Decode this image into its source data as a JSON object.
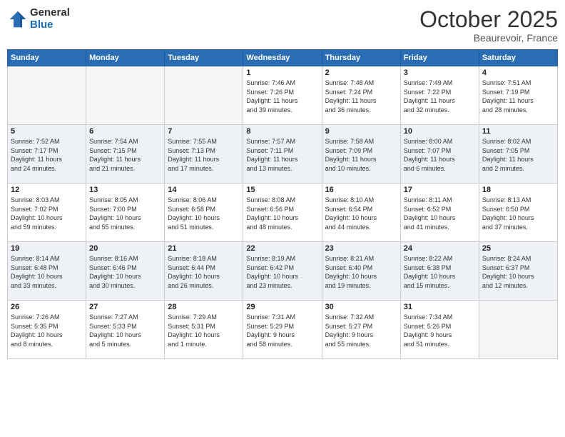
{
  "logo": {
    "general": "General",
    "blue": "Blue"
  },
  "header": {
    "month": "October 2025",
    "location": "Beaurevoir, France"
  },
  "days_of_week": [
    "Sunday",
    "Monday",
    "Tuesday",
    "Wednesday",
    "Thursday",
    "Friday",
    "Saturday"
  ],
  "weeks": [
    [
      {
        "day": "",
        "info": ""
      },
      {
        "day": "",
        "info": ""
      },
      {
        "day": "",
        "info": ""
      },
      {
        "day": "1",
        "info": "Sunrise: 7:46 AM\nSunset: 7:26 PM\nDaylight: 11 hours\nand 39 minutes."
      },
      {
        "day": "2",
        "info": "Sunrise: 7:48 AM\nSunset: 7:24 PM\nDaylight: 11 hours\nand 36 minutes."
      },
      {
        "day": "3",
        "info": "Sunrise: 7:49 AM\nSunset: 7:22 PM\nDaylight: 11 hours\nand 32 minutes."
      },
      {
        "day": "4",
        "info": "Sunrise: 7:51 AM\nSunset: 7:19 PM\nDaylight: 11 hours\nand 28 minutes."
      }
    ],
    [
      {
        "day": "5",
        "info": "Sunrise: 7:52 AM\nSunset: 7:17 PM\nDaylight: 11 hours\nand 24 minutes."
      },
      {
        "day": "6",
        "info": "Sunrise: 7:54 AM\nSunset: 7:15 PM\nDaylight: 11 hours\nand 21 minutes."
      },
      {
        "day": "7",
        "info": "Sunrise: 7:55 AM\nSunset: 7:13 PM\nDaylight: 11 hours\nand 17 minutes."
      },
      {
        "day": "8",
        "info": "Sunrise: 7:57 AM\nSunset: 7:11 PM\nDaylight: 11 hours\nand 13 minutes."
      },
      {
        "day": "9",
        "info": "Sunrise: 7:58 AM\nSunset: 7:09 PM\nDaylight: 11 hours\nand 10 minutes."
      },
      {
        "day": "10",
        "info": "Sunrise: 8:00 AM\nSunset: 7:07 PM\nDaylight: 11 hours\nand 6 minutes."
      },
      {
        "day": "11",
        "info": "Sunrise: 8:02 AM\nSunset: 7:05 PM\nDaylight: 11 hours\nand 2 minutes."
      }
    ],
    [
      {
        "day": "12",
        "info": "Sunrise: 8:03 AM\nSunset: 7:02 PM\nDaylight: 10 hours\nand 59 minutes."
      },
      {
        "day": "13",
        "info": "Sunrise: 8:05 AM\nSunset: 7:00 PM\nDaylight: 10 hours\nand 55 minutes."
      },
      {
        "day": "14",
        "info": "Sunrise: 8:06 AM\nSunset: 6:58 PM\nDaylight: 10 hours\nand 51 minutes."
      },
      {
        "day": "15",
        "info": "Sunrise: 8:08 AM\nSunset: 6:56 PM\nDaylight: 10 hours\nand 48 minutes."
      },
      {
        "day": "16",
        "info": "Sunrise: 8:10 AM\nSunset: 6:54 PM\nDaylight: 10 hours\nand 44 minutes."
      },
      {
        "day": "17",
        "info": "Sunrise: 8:11 AM\nSunset: 6:52 PM\nDaylight: 10 hours\nand 41 minutes."
      },
      {
        "day": "18",
        "info": "Sunrise: 8:13 AM\nSunset: 6:50 PM\nDaylight: 10 hours\nand 37 minutes."
      }
    ],
    [
      {
        "day": "19",
        "info": "Sunrise: 8:14 AM\nSunset: 6:48 PM\nDaylight: 10 hours\nand 33 minutes."
      },
      {
        "day": "20",
        "info": "Sunrise: 8:16 AM\nSunset: 6:46 PM\nDaylight: 10 hours\nand 30 minutes."
      },
      {
        "day": "21",
        "info": "Sunrise: 8:18 AM\nSunset: 6:44 PM\nDaylight: 10 hours\nand 26 minutes."
      },
      {
        "day": "22",
        "info": "Sunrise: 8:19 AM\nSunset: 6:42 PM\nDaylight: 10 hours\nand 23 minutes."
      },
      {
        "day": "23",
        "info": "Sunrise: 8:21 AM\nSunset: 6:40 PM\nDaylight: 10 hours\nand 19 minutes."
      },
      {
        "day": "24",
        "info": "Sunrise: 8:22 AM\nSunset: 6:38 PM\nDaylight: 10 hours\nand 15 minutes."
      },
      {
        "day": "25",
        "info": "Sunrise: 8:24 AM\nSunset: 6:37 PM\nDaylight: 10 hours\nand 12 minutes."
      }
    ],
    [
      {
        "day": "26",
        "info": "Sunrise: 7:26 AM\nSunset: 5:35 PM\nDaylight: 10 hours\nand 8 minutes."
      },
      {
        "day": "27",
        "info": "Sunrise: 7:27 AM\nSunset: 5:33 PM\nDaylight: 10 hours\nand 5 minutes."
      },
      {
        "day": "28",
        "info": "Sunrise: 7:29 AM\nSunset: 5:31 PM\nDaylight: 10 hours\nand 1 minute."
      },
      {
        "day": "29",
        "info": "Sunrise: 7:31 AM\nSunset: 5:29 PM\nDaylight: 9 hours\nand 58 minutes."
      },
      {
        "day": "30",
        "info": "Sunrise: 7:32 AM\nSunset: 5:27 PM\nDaylight: 9 hours\nand 55 minutes."
      },
      {
        "day": "31",
        "info": "Sunrise: 7:34 AM\nSunset: 5:26 PM\nDaylight: 9 hours\nand 51 minutes."
      },
      {
        "day": "",
        "info": ""
      }
    ]
  ]
}
